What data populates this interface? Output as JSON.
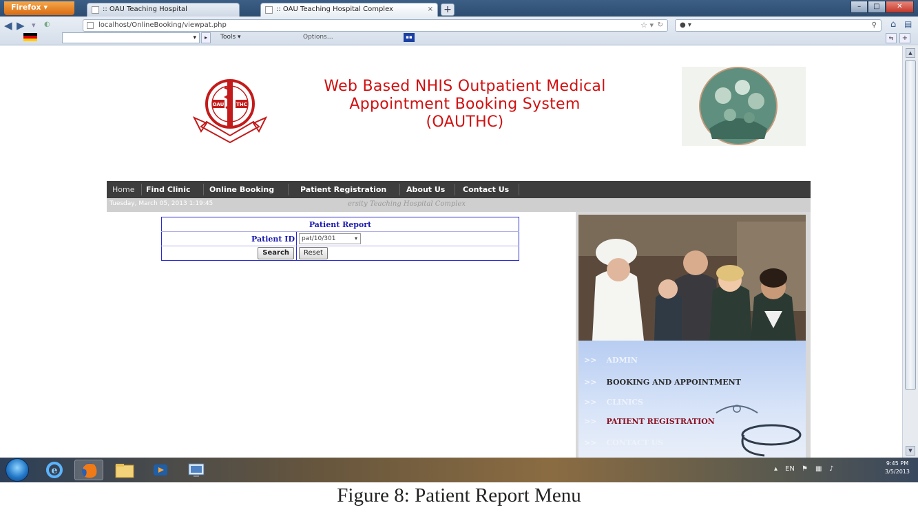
{
  "browser": {
    "app_button": "Firefox",
    "tabs": [
      {
        "label": ":: OAU Teaching Hospital"
      },
      {
        "label": ":: OAU Teaching Hospital Complex"
      }
    ],
    "url": "localhost/OnlineBooking/viewpat.php",
    "search_placeholder": "",
    "toolbar_tools": "Tools",
    "toolbar_options": "Options"
  },
  "header": {
    "title_line1": "Web Based NHIS Outpatient Medical",
    "title_line2": "Appointment Booking System",
    "title_line3": "(OAUTHC)",
    "logo_text_left": "OAU",
    "logo_text_right": "THC"
  },
  "menu": {
    "items": [
      "Home",
      "Find Clinic",
      "Online Booking",
      "Patient Registration",
      "About Us",
      "Contact Us"
    ]
  },
  "subbar": {
    "date": "Tuesday, March 05, 2013 1:19:45",
    "marquee": "ersity Teaching Hospital Complex"
  },
  "form": {
    "title": "Patient Report",
    "patient_id_label": "Patient ID",
    "patient_id_value": "pat/10/301",
    "search_button": "Search",
    "reset_button": "Reset"
  },
  "side_menu": {
    "items": [
      {
        "arrows": ">>",
        "label": "ADMIN",
        "color": "#eef3fb"
      },
      {
        "arrows": ">>",
        "label": "BOOKING AND APPOINTMENT",
        "color": "#2a2a2a"
      },
      {
        "arrows": ">>",
        "label": "CLINICS",
        "color": "#eef3fb"
      },
      {
        "arrows": ">>",
        "label": "PATIENT REGISTRATION",
        "color": "#8b1020"
      },
      {
        "arrows": ">>",
        "label": "CONTACT US",
        "color": "#eef3fb"
      }
    ]
  },
  "taskbar": {
    "time": "9:45 PM",
    "date": "3/5/2013"
  },
  "caption": "Figure 8: Patient Report Menu",
  "colors": {
    "title_red": "#d01010",
    "menu_bg": "#3d3d3d",
    "form_blue": "#1a1ab0"
  }
}
